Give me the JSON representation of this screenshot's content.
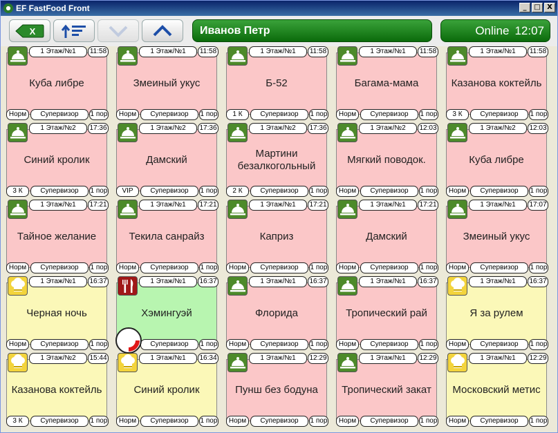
{
  "window": {
    "title": "EF FastFood Front",
    "controls": [
      "_",
      "□",
      "X"
    ]
  },
  "toolbar": {
    "exit_label": "X",
    "user": "Иванов Петр",
    "status": "Online",
    "clock": "12:07"
  },
  "orders": [
    {
      "loc": "1 Этаж/№1",
      "time": "11:58",
      "name": "Куба либре",
      "kind": "Норм",
      "role": "Супервизор",
      "portion": "1 пор",
      "icon": "cloche-icon",
      "color": "pink"
    },
    {
      "loc": "1 Этаж/№1",
      "time": "11:58",
      "name": "Змеиный укус",
      "kind": "Норм",
      "role": "Супервизор",
      "portion": "1 пор",
      "icon": "cloche-icon",
      "color": "pink"
    },
    {
      "loc": "1 Этаж/№1",
      "time": "11:58",
      "name": "Б-52",
      "kind": "1 К",
      "role": "Супервизор",
      "portion": "1 пор",
      "icon": "cloche-icon",
      "color": "pink"
    },
    {
      "loc": "1 Этаж/№1",
      "time": "11:58",
      "name": "Багама-мама",
      "kind": "Норм",
      "role": "Супервизор",
      "portion": "1 пор",
      "icon": "cloche-icon",
      "color": "pink"
    },
    {
      "loc": "1 Этаж/№1",
      "time": "11:58",
      "name": "Казанова коктейль",
      "kind": "3 К",
      "role": "Супервизор",
      "portion": "1 пор",
      "icon": "cloche-icon",
      "color": "pink"
    },
    {
      "loc": "1 Этаж/№2",
      "time": "17:36",
      "name": "Синий кролик",
      "kind": "3 К",
      "role": "Супервизор",
      "portion": "1 пор",
      "icon": "cloche-icon",
      "color": "pink"
    },
    {
      "loc": "1 Этаж/№2",
      "time": "17:36",
      "name": "Дамский",
      "kind": "VIP",
      "role": "Супервизор",
      "portion": "1 пор",
      "icon": "cloche-icon",
      "color": "pink"
    },
    {
      "loc": "1 Этаж/№2",
      "time": "17:36",
      "name": "Мартини безалкогольный",
      "kind": "2 К",
      "role": "Супервизор",
      "portion": "1 пор",
      "icon": "cloche-icon",
      "color": "pink"
    },
    {
      "loc": "1 Этаж/№2",
      "time": "12:03",
      "name": "Мягкий поводок.",
      "kind": "Норм",
      "role": "Супервизор",
      "portion": "1 пор",
      "icon": "cloche-icon",
      "color": "pink"
    },
    {
      "loc": "1 Этаж/№2",
      "time": "12:03",
      "name": "Куба либре",
      "kind": "Норм",
      "role": "Супервизор",
      "portion": "1 пор",
      "icon": "cloche-icon",
      "color": "pink"
    },
    {
      "loc": "1 Этаж/№1",
      "time": "17:21",
      "name": "Тайное желание",
      "kind": "Норм",
      "role": "Супервизор",
      "portion": "1 пор",
      "icon": "cloche-icon",
      "color": "pink"
    },
    {
      "loc": "1 Этаж/№1",
      "time": "17:21",
      "name": "Текила санрайз",
      "kind": "Норм",
      "role": "Супервизор",
      "portion": "1 пор",
      "icon": "cloche-icon",
      "color": "pink"
    },
    {
      "loc": "1 Этаж/№1",
      "time": "17:21",
      "name": "Каприз",
      "kind": "Норм",
      "role": "Супервизор",
      "portion": "1 пор",
      "icon": "cloche-icon",
      "color": "pink"
    },
    {
      "loc": "1 Этаж/№1",
      "time": "17:21",
      "name": "Дамский",
      "kind": "Норм",
      "role": "Супервизор",
      "portion": "1 пор",
      "icon": "cloche-icon",
      "color": "pink"
    },
    {
      "loc": "1 Этаж/№1",
      "time": "17:07",
      "name": "Змеиный укус",
      "kind": "Норм",
      "role": "Супервизор",
      "portion": "1 пор",
      "icon": "cloche-icon",
      "color": "pink"
    },
    {
      "loc": "1 Этаж/№1",
      "time": "16:37",
      "name": "Черная ночь",
      "kind": "Норм",
      "role": "Супервизор",
      "portion": "1 пор",
      "icon": "chef-hat-icon",
      "color": "yellow"
    },
    {
      "loc": "1 Этаж/№1",
      "time": "16:37",
      "name": "Хэмингуэй",
      "kind": "",
      "role": "Супервизор",
      "portion": "1 пор",
      "icon": "fork-knife-icon",
      "color": "green"
    },
    {
      "loc": "1 Этаж/№1",
      "time": "16:37",
      "name": "Флорида",
      "kind": "Норм",
      "role": "Супервизор",
      "portion": "1 пор",
      "icon": "cloche-icon",
      "color": "pink"
    },
    {
      "loc": "1 Этаж/№1",
      "time": "16:37",
      "name": "Тропический рай",
      "kind": "Норм",
      "role": "Супервизор",
      "portion": "1 пор",
      "icon": "cloche-icon",
      "color": "pink"
    },
    {
      "loc": "1 Этаж/№1",
      "time": "16:37",
      "name": "Я за рулем",
      "kind": "Норм",
      "role": "Супервизор",
      "portion": "1 пор",
      "icon": "chef-hat-icon",
      "color": "yellow"
    },
    {
      "loc": "1 Этаж/№2",
      "time": "15:44",
      "name": "Казанова коктейль",
      "kind": "3 К",
      "role": "Супервизор",
      "portion": "1 пор",
      "icon": "chef-hat-icon",
      "color": "yellow"
    },
    {
      "loc": "1 Этаж/№1",
      "time": "16:34",
      "name": "Синий кролик",
      "kind": "Норм",
      "role": "Супервизор",
      "portion": "1 пор",
      "icon": "chef-hat-icon",
      "color": "yellow"
    },
    {
      "loc": "1 Этаж/№1",
      "time": "12:29",
      "name": "Пунш без бодуна",
      "kind": "Норм",
      "role": "Супервизор",
      "portion": "1 пор",
      "icon": "cloche-icon",
      "color": "pink"
    },
    {
      "loc": "1 Этаж/№1",
      "time": "12:29",
      "name": "Тропический закат",
      "kind": "Норм",
      "role": "Супервизор",
      "portion": "1 пор",
      "icon": "cloche-icon",
      "color": "pink"
    },
    {
      "loc": "1 Этаж/№1",
      "time": "12:29",
      "name": "Московский метис",
      "kind": "Норм",
      "role": "Супервизор",
      "portion": "1 пор",
      "icon": "chef-hat-icon",
      "color": "yellow"
    }
  ],
  "colors": {
    "pink": "#fbc7c8",
    "yellow": "#fbf8b8",
    "green": "#b8f5b0",
    "accent": "#1f8a1f"
  }
}
